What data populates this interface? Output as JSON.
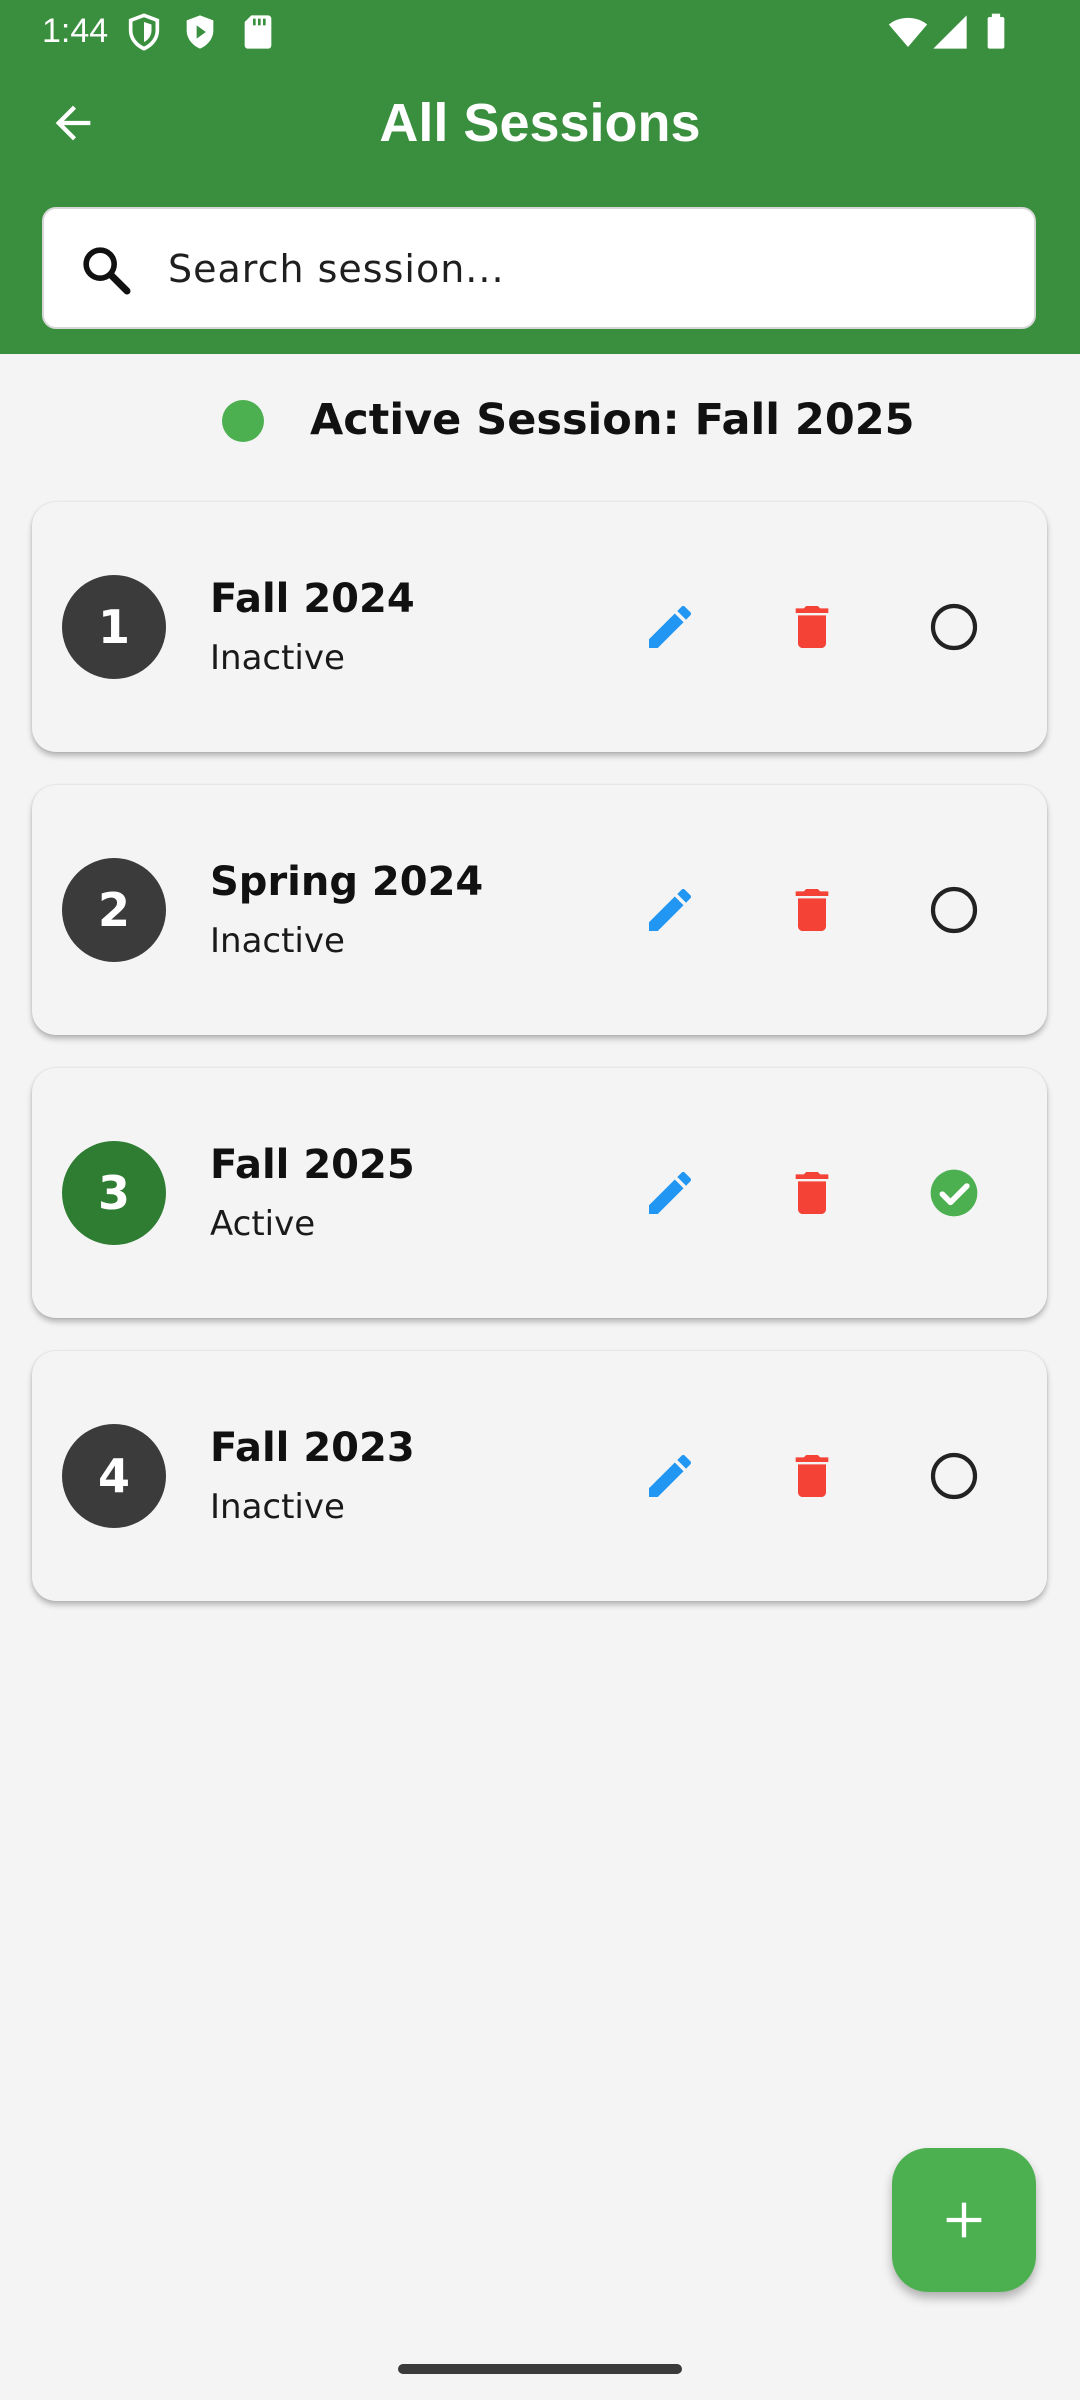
{
  "status_bar": {
    "time": "1:44",
    "icons": [
      "shield-icon",
      "play-protect-icon",
      "sd-card-icon",
      "wifi-icon",
      "signal-icon",
      "battery-icon"
    ]
  },
  "toolbar": {
    "back_icon": "arrow-back-icon",
    "title": "All Sessions"
  },
  "search": {
    "placeholder": "Search session...",
    "value": ""
  },
  "active_banner": {
    "text": "Active Session: Fall 2025",
    "dot_color": "#4caf50"
  },
  "sessions": [
    {
      "number": "1",
      "name": "Fall 2024",
      "status": "Inactive",
      "selected": false
    },
    {
      "number": "2",
      "name": "Spring 2024",
      "status": "Inactive",
      "selected": false
    },
    {
      "number": "3",
      "name": "Fall 2025",
      "status": "Active",
      "selected": true
    },
    {
      "number": "4",
      "name": "Fall 2023",
      "status": "Inactive",
      "selected": false
    }
  ],
  "colors": {
    "header": "#3a8f3e",
    "edit": "#2196f3",
    "delete": "#f44336",
    "active_number": "#2e7d32",
    "inactive_number": "#3b3b3b",
    "check": "#4caf50",
    "fab": "#4caf50"
  },
  "fab": {
    "icon": "add-icon"
  }
}
